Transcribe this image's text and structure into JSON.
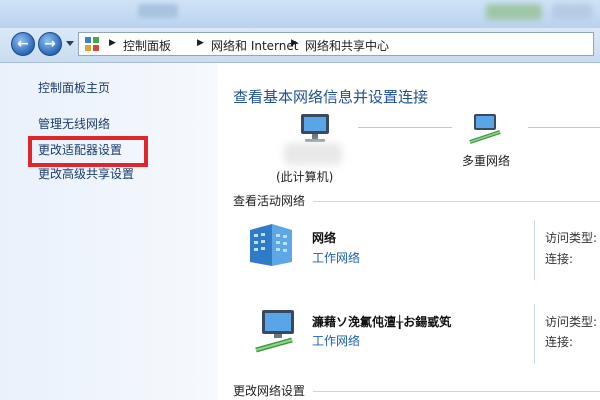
{
  "titlebar": {
    "blurred_title": ""
  },
  "nav": {
    "back_glyph": "←",
    "forward_glyph": "→",
    "breadcrumb": [
      "控制面板",
      "网络和 Internet",
      "网络和共享中心"
    ],
    "separator": "▶"
  },
  "sidebar": {
    "items": [
      {
        "label": "控制面板主页"
      },
      {
        "label": "管理无线网络"
      },
      {
        "label": "更改适配器设置"
      },
      {
        "label": "更改高级共享设置"
      }
    ]
  },
  "main": {
    "title": "查看基本网络信息并设置连接",
    "map": {
      "computer_label": "(此计算机)",
      "network_label": "多重网络"
    },
    "active_section_label": "查看活动网络",
    "networks": [
      {
        "name": "网络",
        "type": "工作网络",
        "access_label": "访问类型:",
        "connect_label": "连接:"
      },
      {
        "name": "濂藉ソ浼氱伅澶╁お鍚戜笂",
        "type": "工作网络",
        "access_label": "访问类型:",
        "connect_label": "连接:"
      }
    ],
    "change_section_label": "更改网络设置"
  },
  "colors": {
    "link": "#1c5fb3",
    "title": "#1f4f95",
    "highlight_box": "#e0262b"
  }
}
